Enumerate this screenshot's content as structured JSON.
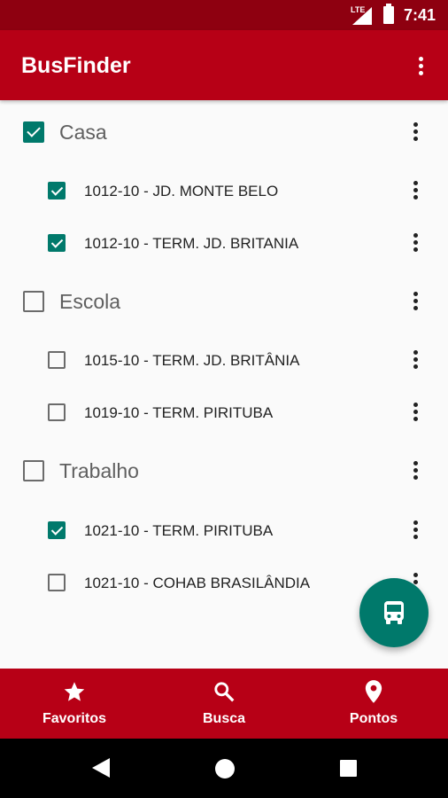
{
  "status_bar": {
    "network": "LTE",
    "time": "7:41"
  },
  "app_bar": {
    "title": "BusFinder",
    "menu_icon": "more-vert-icon"
  },
  "groups": [
    {
      "label": "Casa",
      "checked": true,
      "routes": [
        {
          "label": "1012-10 - JD. MONTE BELO",
          "checked": true
        },
        {
          "label": "1012-10 - TERM. JD. BRITANIA",
          "checked": true
        }
      ]
    },
    {
      "label": "Escola",
      "checked": false,
      "routes": [
        {
          "label": "1015-10 - TERM. JD. BRITÂNIA",
          "checked": false
        },
        {
          "label": "1019-10 - TERM. PIRITUBA",
          "checked": false
        }
      ]
    },
    {
      "label": "Trabalho",
      "checked": false,
      "routes": [
        {
          "label": "1021-10 - TERM. PIRITUBA",
          "checked": true
        },
        {
          "label": "1021-10 - COHAB BRASILÂNDIA",
          "checked": false
        }
      ]
    }
  ],
  "fab": {
    "icon": "bus-icon"
  },
  "bottom_nav": [
    {
      "label": "Favoritos",
      "icon": "star-icon"
    },
    {
      "label": "Busca",
      "icon": "search-icon"
    },
    {
      "label": "Pontos",
      "icon": "location-pin-icon"
    }
  ],
  "colors": {
    "primary": "#b70016",
    "primary_dark": "#8e0010",
    "accent": "#00796b",
    "background": "#fafafa"
  }
}
